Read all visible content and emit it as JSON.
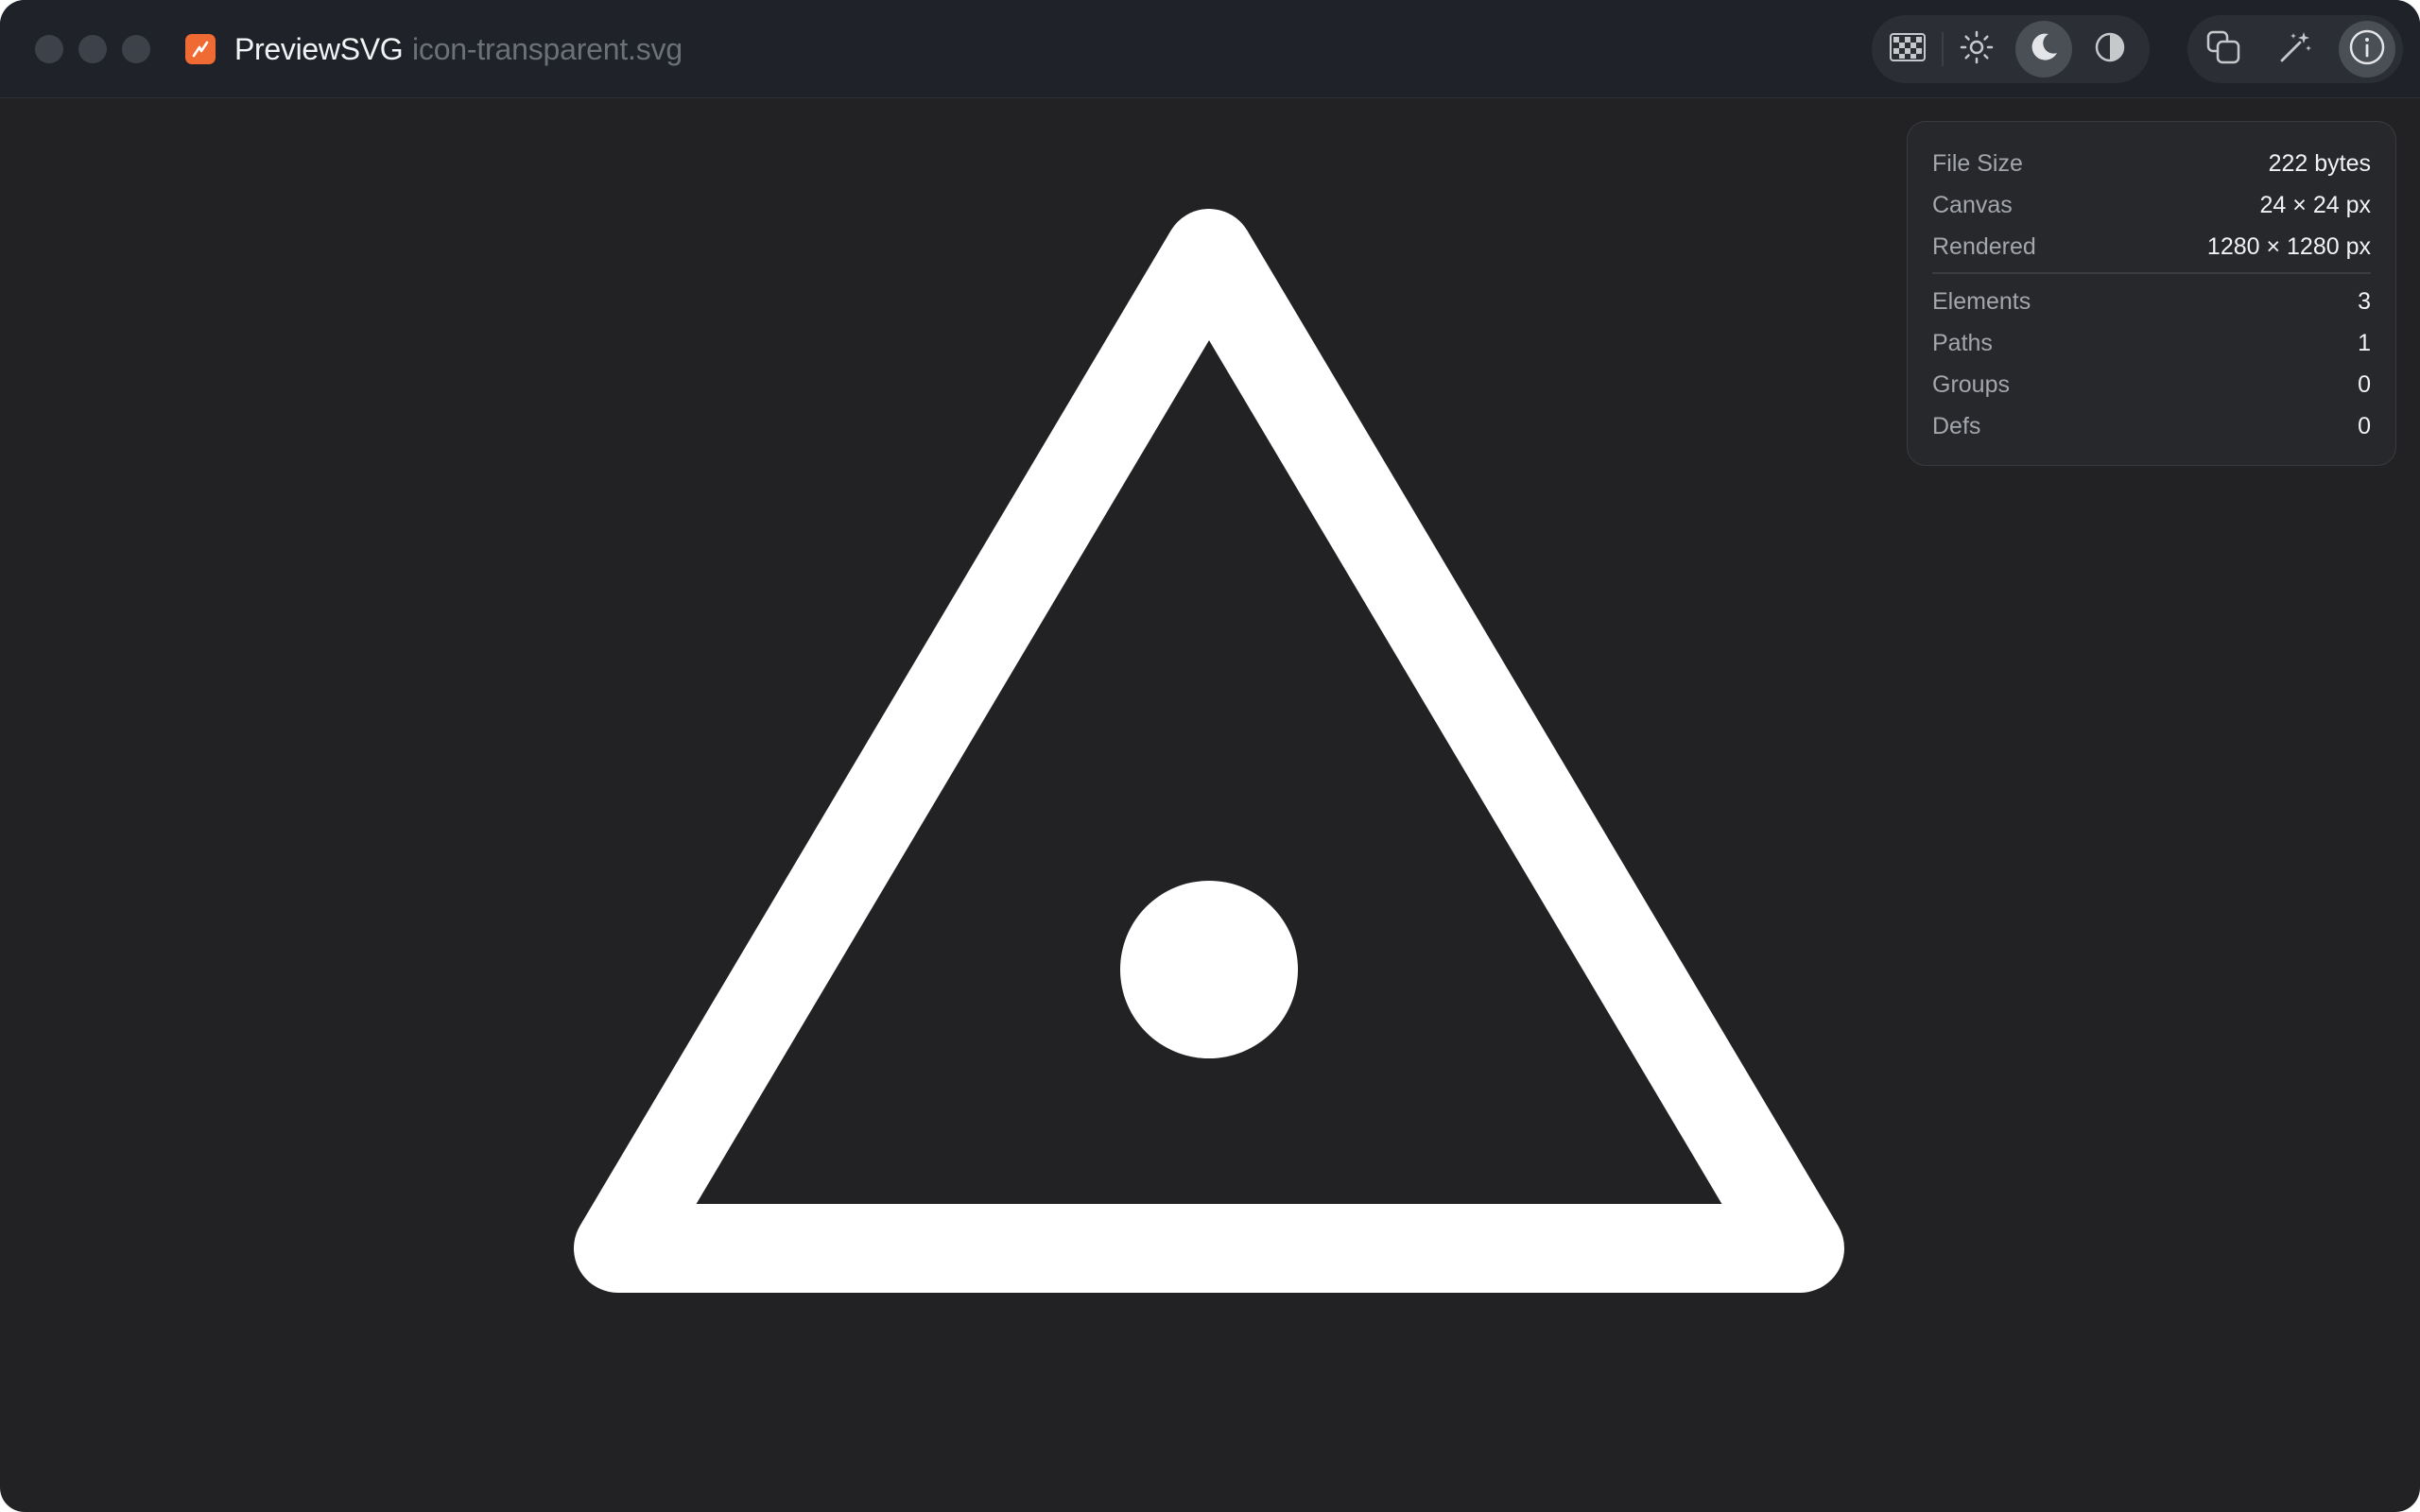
{
  "window": {
    "app_name": "PreviewSVG",
    "file_name": "icon-transparent.svg"
  },
  "toolbar": {
    "view_modes": [
      {
        "name": "checkerboard-background",
        "icon": "checkerboard-icon",
        "active": false
      },
      {
        "name": "light-background",
        "icon": "sun-icon",
        "active": false
      },
      {
        "name": "dark-background",
        "icon": "moon-icon",
        "active": true
      },
      {
        "name": "contrast-background",
        "icon": "contrast-icon",
        "active": false
      }
    ],
    "actions": [
      {
        "name": "copy",
        "icon": "copy-icon",
        "active": false
      },
      {
        "name": "optimize",
        "icon": "magic-wand-icon",
        "active": false
      },
      {
        "name": "info",
        "icon": "info-icon",
        "active": true
      }
    ]
  },
  "info": {
    "file_size_label": "File Size",
    "file_size_value": "222 bytes",
    "canvas_label": "Canvas",
    "canvas_value": "24 × 24 px",
    "rendered_label": "Rendered",
    "rendered_value": "1280 × 1280 px",
    "elements_label": "Elements",
    "elements_value": "3",
    "paths_label": "Paths",
    "paths_value": "1",
    "groups_label": "Groups",
    "groups_value": "0",
    "defs_label": "Defs",
    "defs_value": "0"
  },
  "colors": {
    "accent": "#f06a34",
    "canvas_background": "#222224",
    "titlebar": "#1f2329",
    "svg_fill": "#ffffff"
  }
}
